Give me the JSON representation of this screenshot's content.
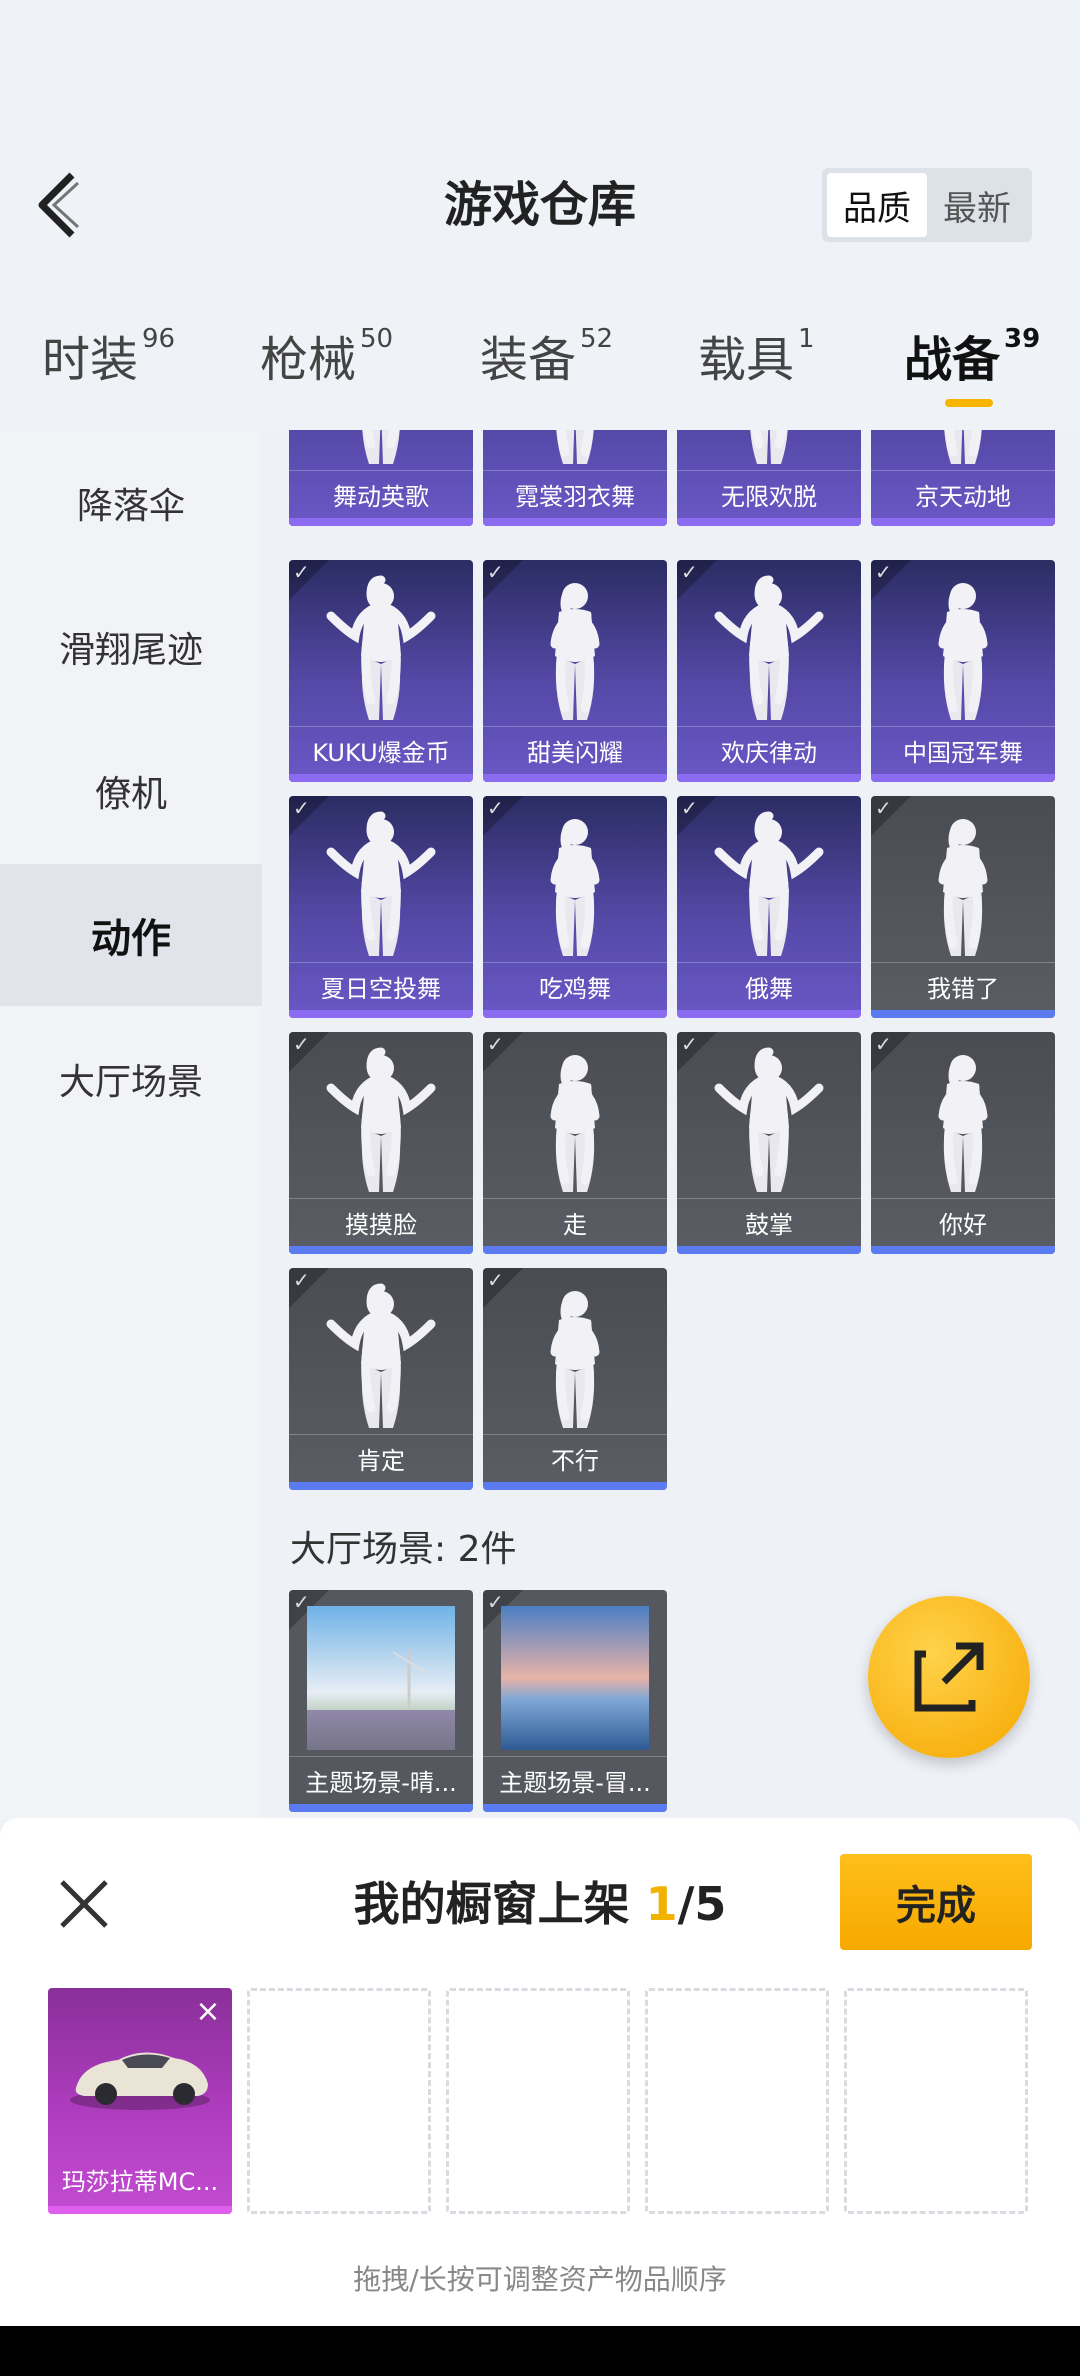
{
  "header": {
    "title": "游戏仓库",
    "sort_options": [
      "品质",
      "最新"
    ],
    "active_sort": "品质"
  },
  "tabs": [
    {
      "label": "时装",
      "count": "96"
    },
    {
      "label": "枪械",
      "count": "50"
    },
    {
      "label": "装备",
      "count": "52"
    },
    {
      "label": "载具",
      "count": "1"
    },
    {
      "label": "战备",
      "count": "39"
    }
  ],
  "active_tab": "战备",
  "sidebar": {
    "items": [
      "降落伞",
      "滑翔尾迹",
      "僚机",
      "动作",
      "大厅场景"
    ],
    "active": "动作"
  },
  "emotes": [
    {
      "label": "舞动英歌",
      "rarity": "purple"
    },
    {
      "label": "霓裳羽衣舞",
      "rarity": "purple"
    },
    {
      "label": "无限欢脱",
      "rarity": "purple"
    },
    {
      "label": "京天动地",
      "rarity": "purple"
    },
    {
      "label": "KUKU爆金币",
      "rarity": "purple"
    },
    {
      "label": "甜美闪耀",
      "rarity": "purple"
    },
    {
      "label": "欢庆律动",
      "rarity": "purple"
    },
    {
      "label": "中国冠军舞",
      "rarity": "purple"
    },
    {
      "label": "夏日空投舞",
      "rarity": "purple"
    },
    {
      "label": "吃鸡舞",
      "rarity": "purple"
    },
    {
      "label": "俄舞",
      "rarity": "purple"
    },
    {
      "label": "我错了",
      "rarity": "grey"
    },
    {
      "label": "摸摸脸",
      "rarity": "grey"
    },
    {
      "label": "走",
      "rarity": "grey"
    },
    {
      "label": "鼓掌",
      "rarity": "grey"
    },
    {
      "label": "你好",
      "rarity": "grey"
    },
    {
      "label": "肯定",
      "rarity": "grey"
    },
    {
      "label": "不行",
      "rarity": "grey"
    }
  ],
  "lobby_section": {
    "title": "大厅场景: 2件",
    "items": [
      {
        "label": "主题场景-晴..."
      },
      {
        "label": "主题场景-冒..."
      }
    ]
  },
  "showcase": {
    "title_prefix": "我的橱窗上架 ",
    "current": "1",
    "total": "/5",
    "done_label": "完成",
    "slots": [
      {
        "label": "玛莎拉蒂MC...",
        "filled": true
      },
      {
        "filled": false
      },
      {
        "filled": false
      },
      {
        "filled": false
      },
      {
        "filled": false
      }
    ],
    "hint": "拖拽/长按可调整资产物品顺序"
  },
  "colors": {
    "accent": "#f7b500",
    "epic_purple": "#5548a6",
    "common_grey": "#55575e",
    "legend_magenta": "#b23ec2"
  }
}
